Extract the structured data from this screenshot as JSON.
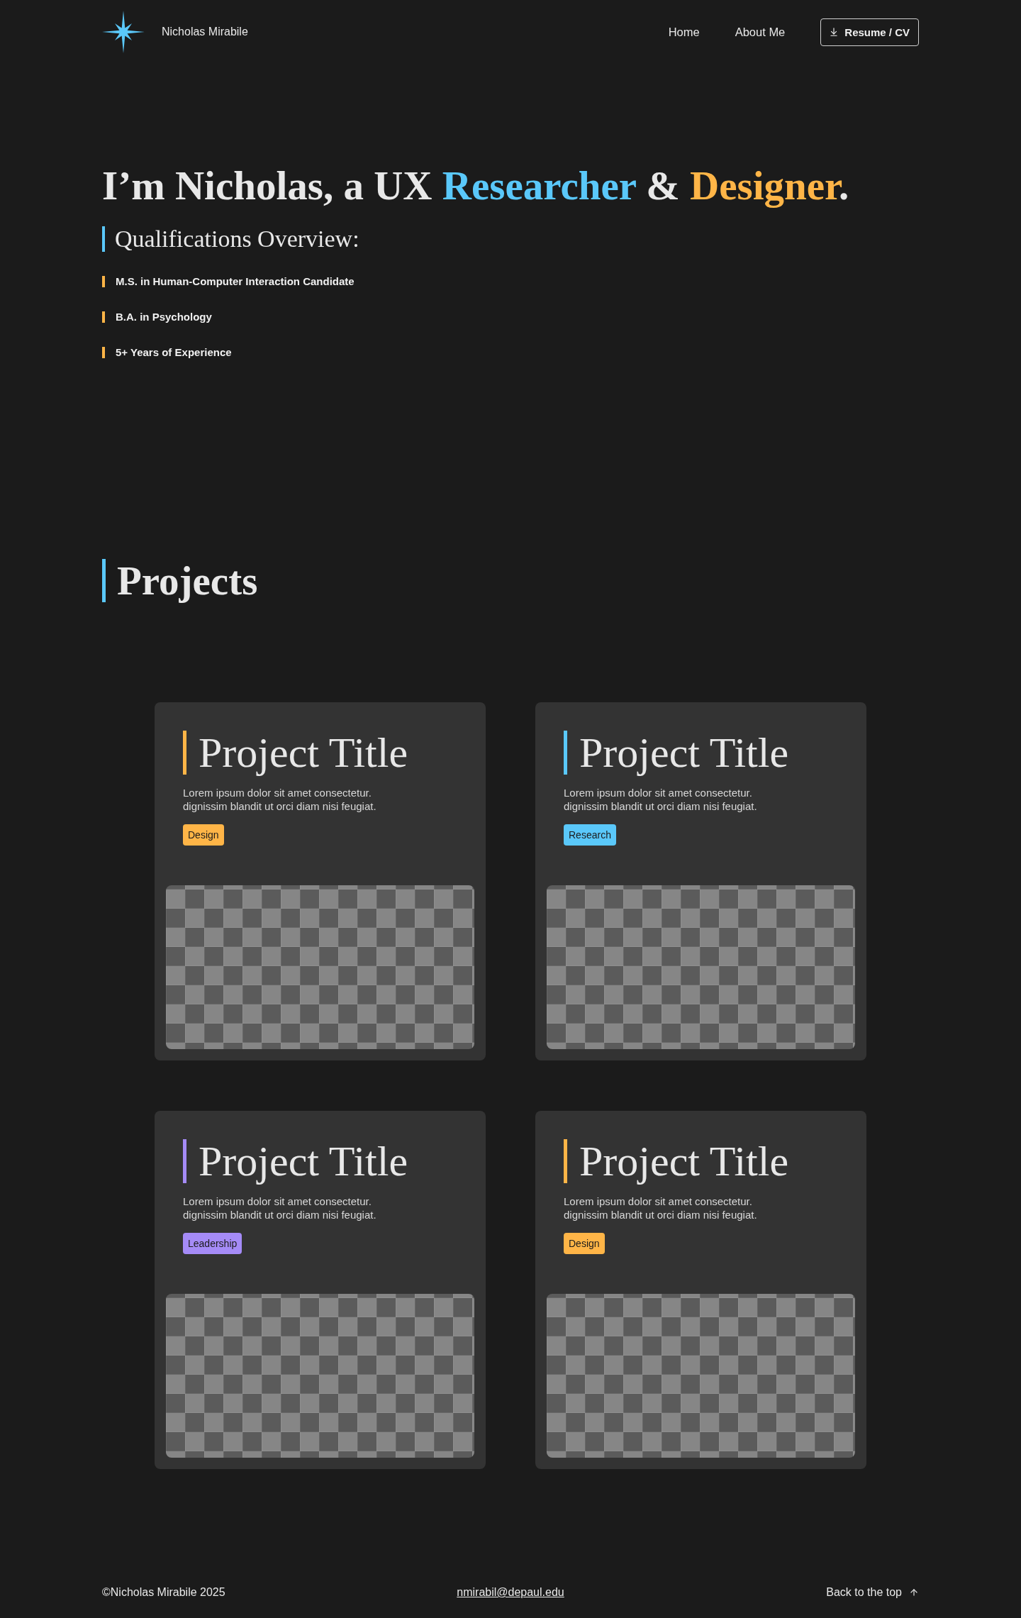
{
  "header": {
    "brand": {
      "name": "Nicholas Mirabile"
    },
    "nav": [
      {
        "label": "Home"
      },
      {
        "label": "About Me"
      }
    ],
    "resume_button": {
      "label": "Resume / CV"
    }
  },
  "hero": {
    "headline": [
      {
        "text": "I’m Nicholas, a UX ",
        "color": "#e8e8e8"
      },
      {
        "text": "Researcher",
        "color": "#5ac8fa"
      },
      {
        "text": " & ",
        "color": "#e8e8e8"
      },
      {
        "text": "Designer",
        "color": "#ffb547"
      },
      {
        "text": ".",
        "color": "#e8e8e8"
      }
    ],
    "qualifications": {
      "title": "Qualifications Overview:",
      "items": [
        {
          "label": "M.S. in Human-Computer Interaction Candidate"
        },
        {
          "label": "B.A. in Psychology"
        },
        {
          "label": "5+ Years of Experience"
        }
      ]
    }
  },
  "projects": {
    "heading": "Projects",
    "cards": [
      {
        "title": "Project Title",
        "description": "Lorem ipsum dolor sit amet consectetur. dignissim blandit ut orci diam nisi feugiat.",
        "tag": {
          "label": "Design",
          "color": "#ffb547"
        }
      },
      {
        "title": "Project Title",
        "description": "Lorem ipsum dolor sit amet consectetur. dignissim blandit ut orci diam nisi feugiat.",
        "tag": {
          "label": "Research",
          "color": "#5ac8fa"
        }
      },
      {
        "title": "Project Title",
        "description": "Lorem ipsum dolor sit amet consectetur. dignissim blandit ut orci diam nisi feugiat.",
        "tag": {
          "label": "Leadership",
          "color": "#a58bf7"
        }
      },
      {
        "title": "Project Title",
        "description": "Lorem ipsum dolor sit amet consectetur. dignissim blandit ut orci diam nisi feugiat.",
        "tag": {
          "label": "Design",
          "color": "#ffb547"
        }
      }
    ]
  },
  "footer": {
    "copyright": "©Nicholas Mirabile 2025",
    "email": "nmirabil@depaul.edu",
    "back_to_top": "Back to the top"
  }
}
